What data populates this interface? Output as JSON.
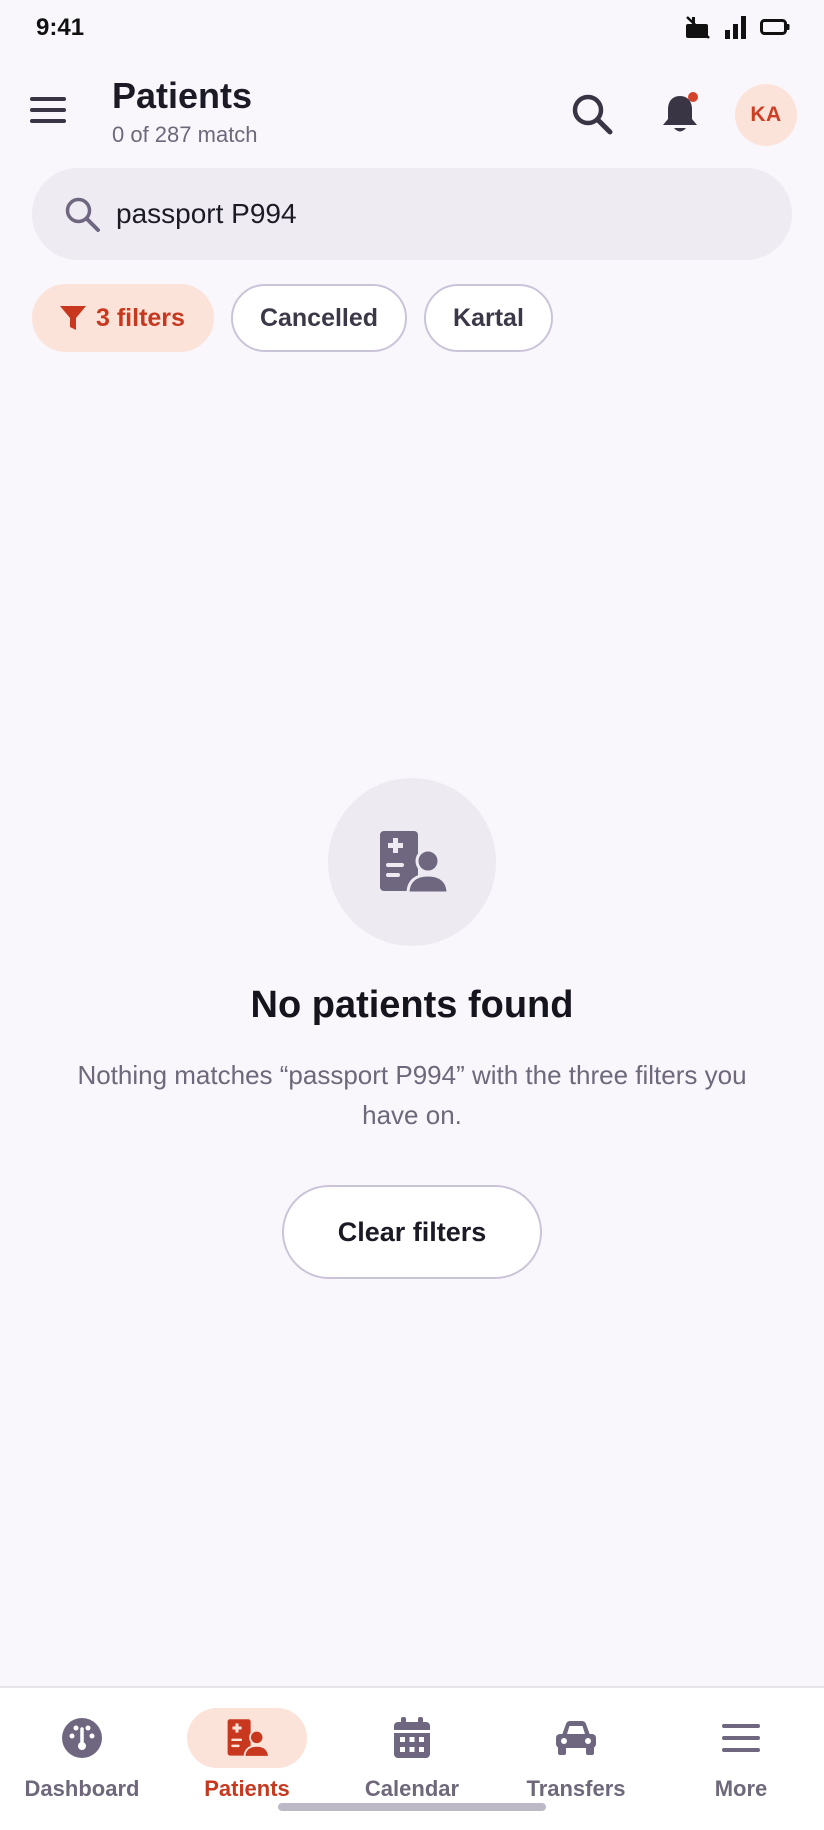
{
  "status_bar": {
    "time": "9:41"
  },
  "header": {
    "title": "Patients",
    "subtitle": "0 of 287 match",
    "avatar_initials": "KA"
  },
  "search": {
    "value": "passport P994"
  },
  "filters": {
    "filter_count_label": "3 filters",
    "chips": [
      "Cancelled",
      "Kartal"
    ]
  },
  "empty_state": {
    "title": "No patients found",
    "message": "Nothing matches “passport P994” with the three filters you have on.",
    "button_label": "Clear filters"
  },
  "bottom_nav": {
    "items": [
      {
        "label": "Dashboard",
        "icon": "gauge-icon"
      },
      {
        "label": "Patients",
        "icon": "patient-file-icon"
      },
      {
        "label": "Calendar",
        "icon": "calendar-icon"
      },
      {
        "label": "Transfers",
        "icon": "car-icon"
      },
      {
        "label": "More",
        "icon": "menu-icon"
      }
    ],
    "active": "Patients"
  },
  "colors": {
    "accent": "#C7381E",
    "accent_soft": "#FCE3DA",
    "background": "#F9F7FC",
    "muted_text": "#6E687A",
    "icon": "#6F6680",
    "notification_dot": "#D2452C"
  }
}
